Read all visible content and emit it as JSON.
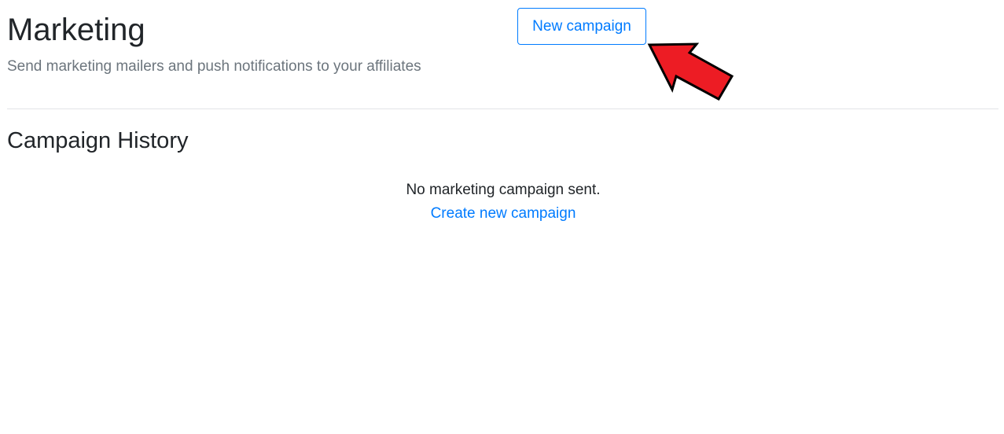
{
  "header": {
    "title": "Marketing",
    "subtitle": "Send marketing mailers and push notifications to your affiliates",
    "new_campaign_label": "New campaign"
  },
  "history": {
    "title": "Campaign History",
    "empty_message": "No marketing campaign sent.",
    "create_link_label": "Create new campaign"
  },
  "annotation": {
    "arrow_icon": "red-arrow-icon",
    "arrow_color": "#ed1c24"
  },
  "colors": {
    "primary": "#007bff",
    "muted": "#6c757d",
    "text": "#212529"
  }
}
